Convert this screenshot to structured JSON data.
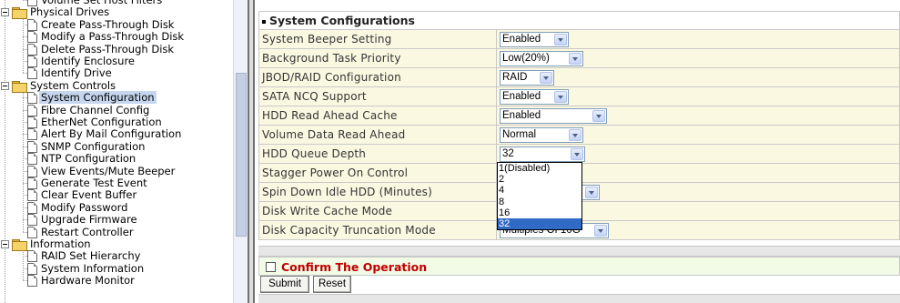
{
  "tree": {
    "items": [
      {
        "label": "Volume Set Host Filters",
        "type": "page",
        "level": 2
      },
      {
        "label": "Physical Drives",
        "type": "folder",
        "level": 1
      },
      {
        "label": "Create Pass-Through Disk",
        "type": "page",
        "level": 2
      },
      {
        "label": "Modify a Pass-Through Disk",
        "type": "page",
        "level": 2
      },
      {
        "label": "Delete Pass-Through Disk",
        "type": "page",
        "level": 2
      },
      {
        "label": "Identify Enclosure",
        "type": "page",
        "level": 2
      },
      {
        "label": "Identify Drive",
        "type": "page",
        "level": 2
      },
      {
        "label": "System Controls",
        "type": "folder",
        "level": 1
      },
      {
        "label": "System Configuration",
        "type": "page",
        "level": 2,
        "selected": true
      },
      {
        "label": "Fibre Channel Config",
        "type": "page",
        "level": 2
      },
      {
        "label": "EtherNet Configuration",
        "type": "page",
        "level": 2
      },
      {
        "label": "Alert By Mail Configuration",
        "type": "page",
        "level": 2
      },
      {
        "label": "SNMP Configuration",
        "type": "page",
        "level": 2
      },
      {
        "label": "NTP Configuration",
        "type": "page",
        "level": 2
      },
      {
        "label": "View Events/Mute Beeper",
        "type": "page",
        "level": 2
      },
      {
        "label": "Generate Test Event",
        "type": "page",
        "level": 2
      },
      {
        "label": "Clear Event Buffer",
        "type": "page",
        "level": 2
      },
      {
        "label": "Modify Password",
        "type": "page",
        "level": 2
      },
      {
        "label": "Upgrade Firmware",
        "type": "page",
        "level": 2
      },
      {
        "label": "Restart Controller",
        "type": "page",
        "level": 2
      },
      {
        "label": "Information",
        "type": "folder",
        "level": 1
      },
      {
        "label": "RAID Set Hierarchy",
        "type": "page",
        "level": 2
      },
      {
        "label": "System Information",
        "type": "page",
        "level": 2
      },
      {
        "label": "Hardware Monitor",
        "type": "page",
        "level": 2
      }
    ]
  },
  "panel": {
    "title": "System Configurations",
    "rows": [
      {
        "label": "System Beeper Setting",
        "value": "Enabled",
        "width": 76
      },
      {
        "label": "Background Task Priority",
        "value": "Low(20%)",
        "width": 92
      },
      {
        "label": "JBOD/RAID Configuration",
        "value": "RAID",
        "width": 60
      },
      {
        "label": "SATA NCQ Support",
        "value": "Enabled",
        "width": 76
      },
      {
        "label": "HDD Read Ahead Cache",
        "value": "Enabled",
        "width": 118
      },
      {
        "label": "Volume Data Read Ahead",
        "value": "Normal",
        "width": 92
      },
      {
        "label": "HDD Queue Depth",
        "value": "32",
        "width": 94
      },
      {
        "label": "Stagger Power On Control",
        "value": "",
        "width": 0
      },
      {
        "label": "Spin Down Idle HDD (Minutes)",
        "value": "",
        "width": 110
      },
      {
        "label": "Disk Write Cache Mode",
        "value": "",
        "width": 0
      },
      {
        "label": "Disk Capacity Truncation Mode",
        "value": "Multiples Of 10G",
        "width": 120
      }
    ]
  },
  "dropdown": {
    "options": [
      "1(Disabled)",
      "2",
      "4",
      "8",
      "16",
      "32"
    ],
    "highlighted": "32"
  },
  "confirm": {
    "label": "Confirm The Operation",
    "checked": false
  },
  "buttons": {
    "submit": "Submit",
    "reset": "Reset"
  },
  "colors": {
    "row_bg": "#fbf8e2",
    "confirm_bg": "#f1fbe6",
    "confirm_text": "#c00000",
    "highlight": "#316ac5"
  }
}
